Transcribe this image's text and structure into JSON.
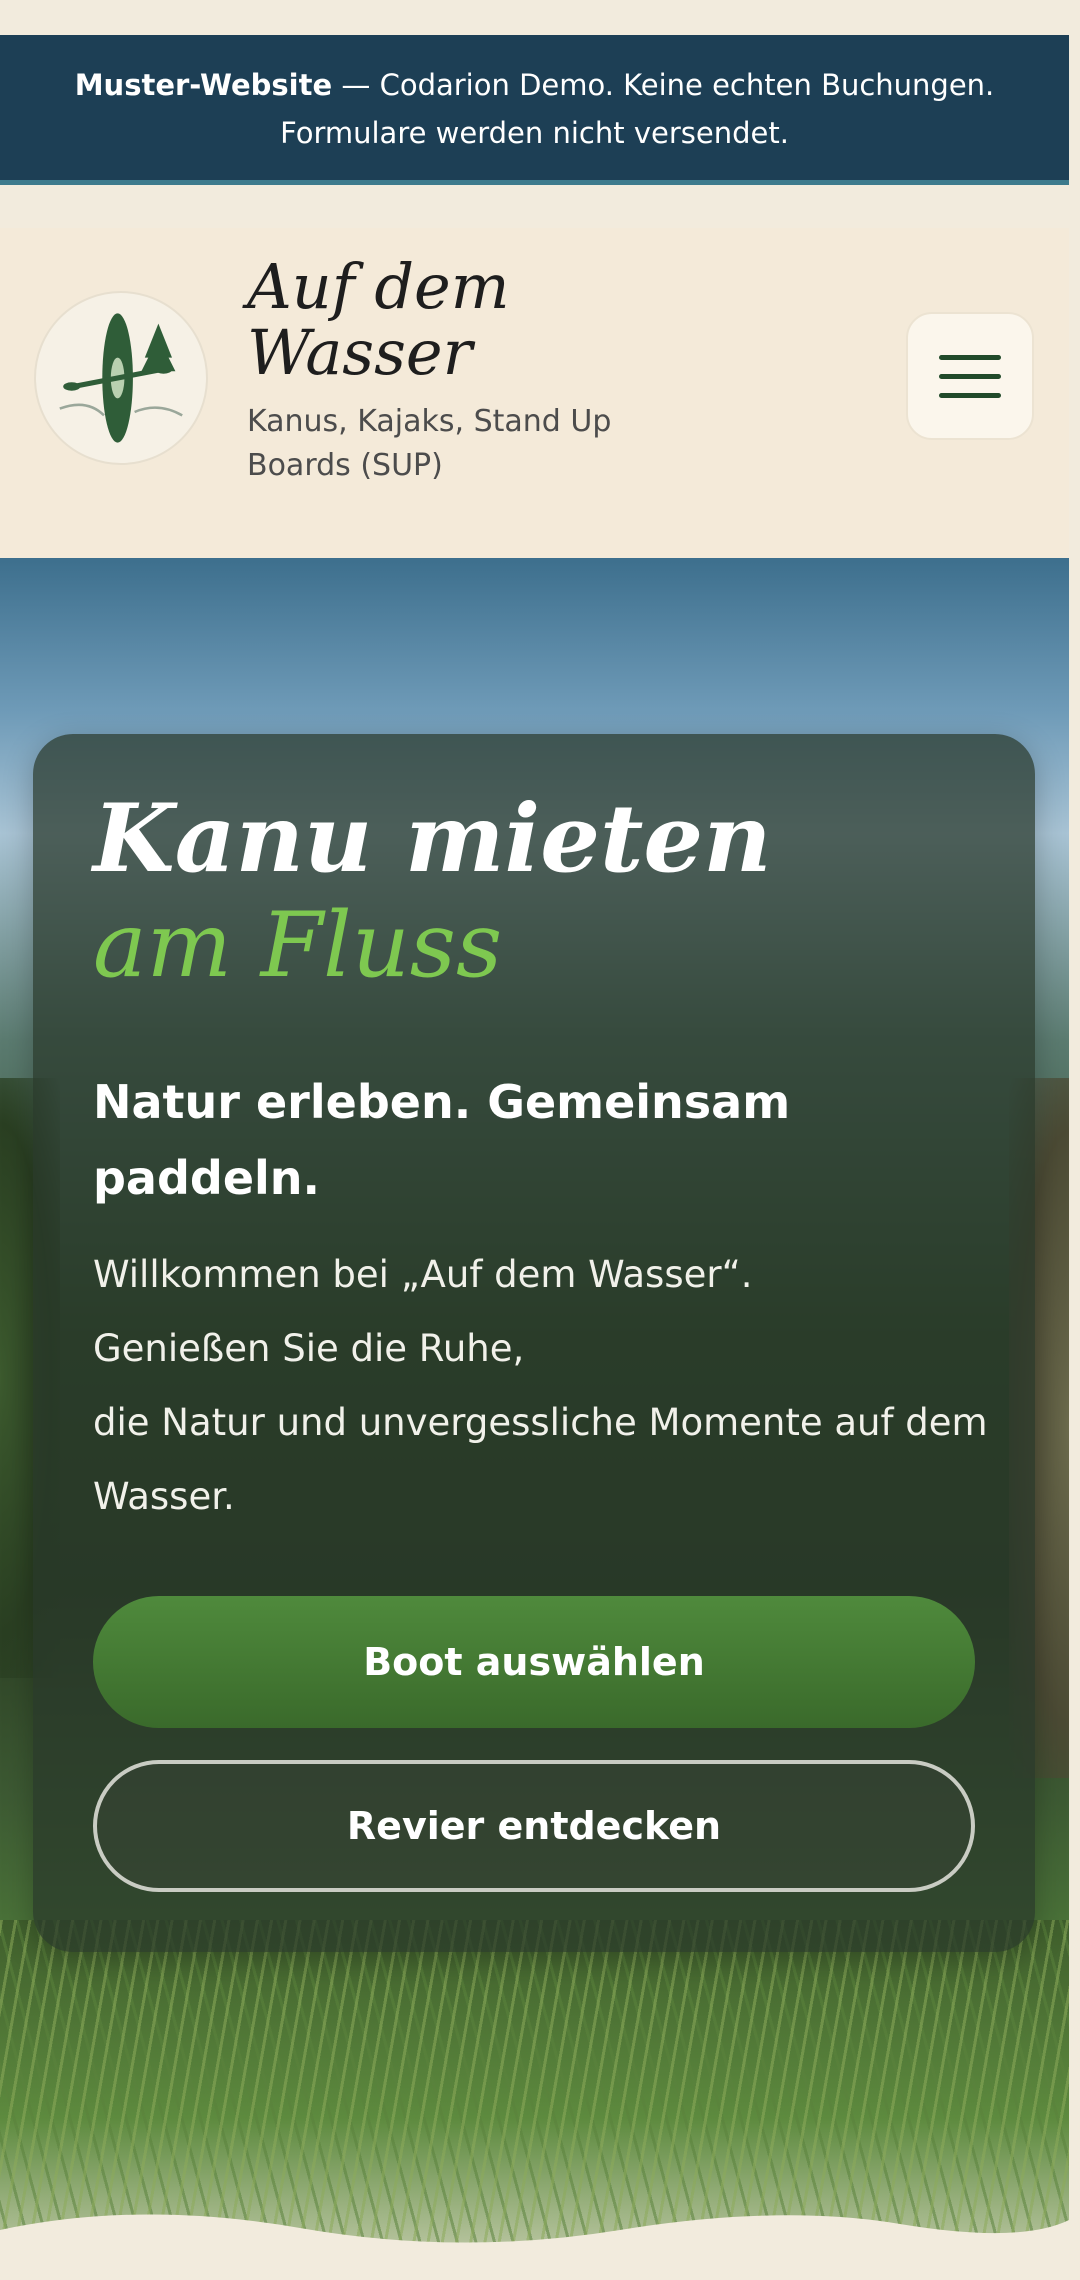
{
  "banner": {
    "strong": "Muster-Website",
    "line1_rest": " — Codarion Demo. Keine echten Buchungen.",
    "line2": "Formulare werden nicht versendet."
  },
  "header": {
    "logo_icon": "kayak-trees-icon",
    "title": "Auf dem Wasser",
    "subtitle": "Kanus, Kajaks, Stand Up Boards (SUP)",
    "menu_icon": "hamburger-menu-icon"
  },
  "hero": {
    "title": "Kanu mieten",
    "title_accent": "am Fluss",
    "tagline": "Natur erleben. Gemeinsam paddeln.",
    "text_line1": "Willkommen bei „Auf dem Wasser“.",
    "text_line2": "Genießen Sie die Ruhe,",
    "text_line3": "die Natur und unvergessliche Momente auf dem Wasser.",
    "primary_button": "Boot auswählen",
    "secondary_button": "Revier entdecken"
  },
  "colors": {
    "banner_bg": "#1d3f55",
    "page_bg": "#f2ebdd",
    "accent_green": "#7ec850",
    "button_green": "#4f8a3c"
  }
}
